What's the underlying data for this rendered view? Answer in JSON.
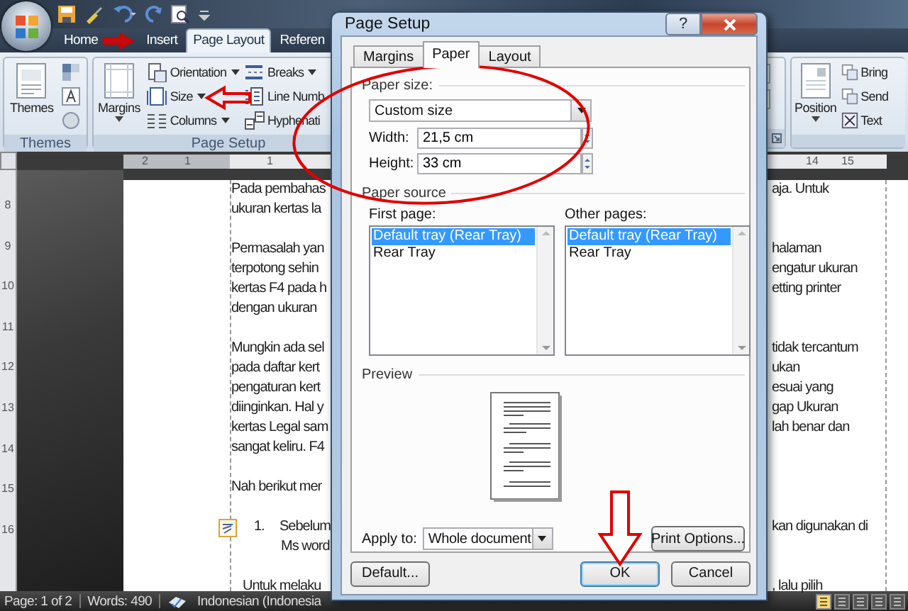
{
  "ribbon_tabs": [
    {
      "label": "Home",
      "selected": false
    },
    {
      "label": "Insert",
      "selected": false
    },
    {
      "label": "Page Layout",
      "selected": true
    },
    {
      "label": "Referen",
      "selected": false
    }
  ],
  "themes_group": {
    "label": "Themes",
    "button": "Themes"
  },
  "page_setup_group": {
    "label": "Page Setup",
    "large_button": "Margins",
    "commands": [
      {
        "label": "Orientation",
        "dropdown": true
      },
      {
        "label": "Size",
        "dropdown": true
      },
      {
        "label": "Columns",
        "dropdown": true
      },
      {
        "label": "Breaks",
        "dropdown": true
      },
      {
        "label": "Line Numb",
        "dropdown": false
      },
      {
        "label": "Hyphenati",
        "dropdown": false
      }
    ]
  },
  "arrange_group": {
    "large_button": "Position",
    "commands": [
      "Bring",
      "Send",
      "Text"
    ]
  },
  "top_ruler": [
    "2",
    "1",
    "1",
    "14",
    "15"
  ],
  "side_ruler": [
    "8",
    "9",
    "10",
    "11",
    "12",
    "13",
    "14",
    "15",
    "16"
  ],
  "document": {
    "paragraphs": [
      {
        "kind": "text",
        "lines": [
          {
            "left": "Pada pembahas",
            "right": "aja. Untuk"
          },
          {
            "left": "ukuran kertas la"
          }
        ]
      },
      {
        "kind": "text",
        "lines": [
          {
            "left": "Permasalah yan",
            "right": "halaman"
          },
          {
            "left": "terpotong sehin",
            "right": "engatur ukuran"
          },
          {
            "left": "kertas F4 pada h",
            "right": "etting printer"
          },
          {
            "left": "dengan ukuran"
          }
        ]
      },
      {
        "kind": "text",
        "lines": [
          {
            "left": "Mungkin ada sel",
            "right": "tidak tercantum"
          },
          {
            "left": "pada daftar kert",
            "right": "ukan"
          },
          {
            "left": "pengaturan kert",
            "right": "esuai yang"
          },
          {
            "left": "diinginkan. Hal y",
            "right": "gap Ukuran"
          },
          {
            "left": "kertas Legal sam",
            "right": "lah benar dan"
          },
          {
            "left": "sangat keliru. F4"
          }
        ]
      },
      {
        "kind": "text",
        "lines": [
          {
            "left": "Nah berikut mer"
          }
        ]
      },
      {
        "kind": "list",
        "number": "1.",
        "lines": [
          {
            "left": "Sebelum",
            "right": "kan digunakan di"
          },
          {
            "left": "Ms word"
          }
        ]
      },
      {
        "kind": "indented",
        "lines": [
          {
            "left": "Untuk melaku",
            "right": ", lalu pilih"
          }
        ]
      }
    ]
  },
  "status_bar": {
    "page": "Page: 1 of 2",
    "words": "Words: 490",
    "language": "Indonesian (Indonesia"
  },
  "dialog": {
    "title": "Page Setup",
    "help_button": "?",
    "tabs": [
      {
        "label": "Margins",
        "selected": false
      },
      {
        "label": "Paper",
        "selected": true
      },
      {
        "label": "Layout",
        "selected": false
      }
    ],
    "paper_size": {
      "label": "Paper size:",
      "value": "Custom size"
    },
    "width": {
      "label": "Width:",
      "value": "21,5 cm"
    },
    "height": {
      "label": "Height:",
      "value": "33 cm"
    },
    "paper_source": {
      "label": "Paper source",
      "first_page": {
        "label": "First page:",
        "items": [
          {
            "text": "Default tray (Rear Tray)",
            "selected": true
          },
          {
            "text": "Rear Tray",
            "selected": false
          }
        ]
      },
      "other_pages": {
        "label": "Other pages:",
        "items": [
          {
            "text": "Default tray (Rear Tray)",
            "selected": true
          },
          {
            "text": "Rear Tray",
            "selected": false
          }
        ]
      }
    },
    "preview": {
      "label": "Preview"
    },
    "apply_to": {
      "label": "Apply to:",
      "value": "Whole document"
    },
    "print_options_button": "Print Options...",
    "footer_buttons": [
      {
        "label": "Default...",
        "default": false
      },
      {
        "label": "OK",
        "default": true
      },
      {
        "label": "Cancel",
        "default": false
      }
    ]
  },
  "annotations": [
    {
      "kind": "arrow-right"
    },
    {
      "kind": "arrow-left"
    },
    {
      "kind": "ellipse"
    },
    {
      "kind": "arrow-down"
    }
  ]
}
